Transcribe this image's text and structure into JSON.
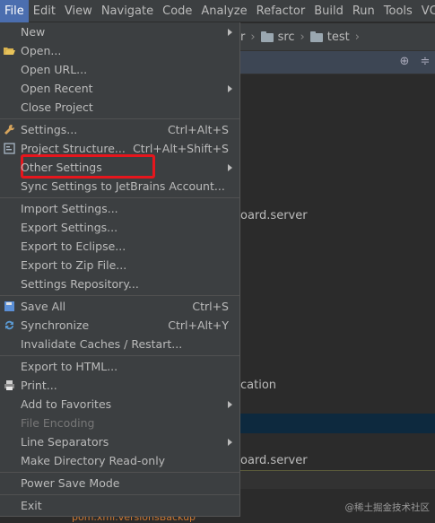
{
  "menubar": [
    {
      "name": "menubar-file",
      "label": "File",
      "active": true
    },
    {
      "name": "menubar-edit",
      "label": "Edit",
      "active": false
    },
    {
      "name": "menubar-view",
      "label": "View",
      "active": false
    },
    {
      "name": "menubar-navigate",
      "label": "Navigate",
      "active": false
    },
    {
      "name": "menubar-code",
      "label": "Code",
      "active": false
    },
    {
      "name": "menubar-analyze",
      "label": "Analyze",
      "active": false
    },
    {
      "name": "menubar-refactor",
      "label": "Refactor",
      "active": false
    },
    {
      "name": "menubar-build",
      "label": "Build",
      "active": false
    },
    {
      "name": "menubar-run",
      "label": "Run",
      "active": false
    },
    {
      "name": "menubar-tools",
      "label": "Tools",
      "active": false
    },
    {
      "name": "menubar-vcs",
      "label": "VCS",
      "active": false
    }
  ],
  "breadcrumb": {
    "prefix": "r",
    "src": "src",
    "test": "test"
  },
  "background": {
    "line1": "oard.server",
    "line2": "cation",
    "line3": "oard.server",
    "footer_peek": "pom.xml.versionsBackup"
  },
  "file_menu": {
    "items": [
      {
        "label": "New",
        "shortcut": "",
        "submenu": true,
        "disabled": false,
        "icon": ""
      },
      {
        "label": "Open...",
        "shortcut": "",
        "submenu": false,
        "disabled": false,
        "icon": "folder-open-icon"
      },
      {
        "label": "Open URL...",
        "shortcut": "",
        "submenu": false,
        "disabled": false,
        "icon": ""
      },
      {
        "label": "Open Recent",
        "shortcut": "",
        "submenu": true,
        "disabled": false,
        "icon": ""
      },
      {
        "label": "Close Project",
        "shortcut": "",
        "submenu": false,
        "disabled": false,
        "icon": ""
      },
      {
        "label": "Settings...",
        "shortcut": "Ctrl+Alt+S",
        "submenu": false,
        "disabled": false,
        "icon": "wrench-icon"
      },
      {
        "label": "Project Structure...",
        "shortcut": "Ctrl+Alt+Shift+S",
        "submenu": false,
        "disabled": false,
        "icon": "project-structure-icon"
      },
      {
        "label": "Other Settings",
        "shortcut": "",
        "submenu": true,
        "disabled": false,
        "icon": ""
      },
      {
        "label": "Sync Settings to JetBrains Account...",
        "shortcut": "",
        "submenu": false,
        "disabled": false,
        "icon": ""
      },
      {
        "label": "Import Settings...",
        "shortcut": "",
        "submenu": false,
        "disabled": false,
        "icon": ""
      },
      {
        "label": "Export Settings...",
        "shortcut": "",
        "submenu": false,
        "disabled": false,
        "icon": ""
      },
      {
        "label": "Export to Eclipse...",
        "shortcut": "",
        "submenu": false,
        "disabled": false,
        "icon": ""
      },
      {
        "label": "Export to Zip File...",
        "shortcut": "",
        "submenu": false,
        "disabled": false,
        "icon": ""
      },
      {
        "label": "Settings Repository...",
        "shortcut": "",
        "submenu": false,
        "disabled": false,
        "icon": ""
      },
      {
        "label": "Save All",
        "shortcut": "Ctrl+S",
        "submenu": false,
        "disabled": false,
        "icon": "save-all-icon"
      },
      {
        "label": "Synchronize",
        "shortcut": "Ctrl+Alt+Y",
        "submenu": false,
        "disabled": false,
        "icon": "synchronize-icon"
      },
      {
        "label": "Invalidate Caches / Restart...",
        "shortcut": "",
        "submenu": false,
        "disabled": false,
        "icon": ""
      },
      {
        "label": "Export to HTML...",
        "shortcut": "",
        "submenu": false,
        "disabled": false,
        "icon": ""
      },
      {
        "label": "Print...",
        "shortcut": "",
        "submenu": false,
        "disabled": false,
        "icon": "print-icon"
      },
      {
        "label": "Add to Favorites",
        "shortcut": "",
        "submenu": true,
        "disabled": false,
        "icon": ""
      },
      {
        "label": "File Encoding",
        "shortcut": "",
        "submenu": false,
        "disabled": true,
        "icon": ""
      },
      {
        "label": "Line Separators",
        "shortcut": "",
        "submenu": true,
        "disabled": false,
        "icon": ""
      },
      {
        "label": "Make Directory Read-only",
        "shortcut": "",
        "submenu": false,
        "disabled": false,
        "icon": ""
      },
      {
        "label": "Power Save Mode",
        "shortcut": "",
        "submenu": false,
        "disabled": false,
        "icon": ""
      },
      {
        "label": "Exit",
        "shortcut": "",
        "submenu": false,
        "disabled": false,
        "icon": ""
      }
    ]
  },
  "watermark": "@稀土掘金技术社区",
  "colors": {
    "menu_bg": "#3c3f41",
    "active_menu": "#4b6eaf",
    "highlight_box": "#e6161d",
    "editor_bg": "#2b2b2b"
  }
}
